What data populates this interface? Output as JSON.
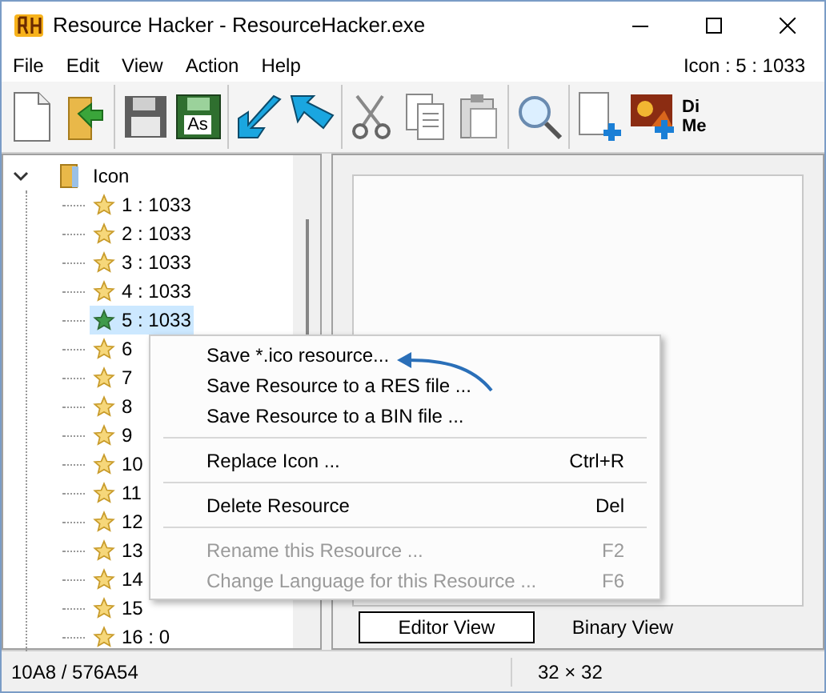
{
  "window": {
    "title": "Resource Hacker - ResourceHacker.exe"
  },
  "menu_bar": [
    "File",
    "Edit",
    "View",
    "Action",
    "Help"
  ],
  "resource_label": "Icon : 5 : 1033",
  "toolbar": [
    {
      "kind": "new"
    },
    {
      "kind": "open"
    },
    {
      "kind": "sep"
    },
    {
      "kind": "save"
    },
    {
      "kind": "saveas",
      "label": "As"
    },
    {
      "kind": "sep"
    },
    {
      "kind": "compile"
    },
    {
      "kind": "decompile"
    },
    {
      "kind": "sep"
    },
    {
      "kind": "cut"
    },
    {
      "kind": "copy"
    },
    {
      "kind": "paste"
    },
    {
      "kind": "sep"
    },
    {
      "kind": "find"
    },
    {
      "kind": "sep"
    },
    {
      "kind": "addblank"
    },
    {
      "kind": "addimage"
    },
    {
      "kind": "text",
      "lines": [
        "Di",
        "Me"
      ]
    }
  ],
  "tree": {
    "label": "Icon",
    "expanded": true,
    "children": [
      {
        "label": "1 : 1033",
        "selected": false
      },
      {
        "label": "2 : 1033",
        "selected": false
      },
      {
        "label": "3 : 1033",
        "selected": false
      },
      {
        "label": "4 : 1033",
        "selected": false
      },
      {
        "label": "5 : 1033",
        "selected": true
      },
      {
        "label": "6",
        "selected": false
      },
      {
        "label": "7",
        "selected": false
      },
      {
        "label": "8",
        "selected": false
      },
      {
        "label": "9",
        "selected": false
      },
      {
        "label": "10",
        "selected": false
      },
      {
        "label": "11",
        "selected": false
      },
      {
        "label": "12",
        "selected": false
      },
      {
        "label": "13",
        "selected": false
      },
      {
        "label": "14",
        "selected": false
      },
      {
        "label": "15",
        "selected": false
      },
      {
        "label": "16 : 0",
        "selected": false
      }
    ]
  },
  "context_menu": [
    {
      "kind": "item",
      "label": "Save *.ico resource...",
      "disabled": false
    },
    {
      "kind": "item",
      "label": "Save Resource to a RES file ...",
      "disabled": false
    },
    {
      "kind": "item",
      "label": "Save Resource to a BIN file ...",
      "disabled": false
    },
    {
      "kind": "sep"
    },
    {
      "kind": "item",
      "label": "Replace Icon ...",
      "shortcut": "Ctrl+R",
      "disabled": false
    },
    {
      "kind": "sep"
    },
    {
      "kind": "item",
      "label": "Delete Resource",
      "shortcut": "Del",
      "disabled": false
    },
    {
      "kind": "sep"
    },
    {
      "kind": "item",
      "label": "Rename this Resource ...",
      "shortcut": "F2",
      "disabled": true
    },
    {
      "kind": "item",
      "label": "Change Language for this Resource ...",
      "shortcut": "F6",
      "disabled": true
    }
  ],
  "view_tabs": [
    {
      "label": "Editor View",
      "selected": true
    },
    {
      "label": "Binary View",
      "selected": false
    }
  ],
  "status_bar": [
    "10A8 / 576A54",
    "32 × 32"
  ]
}
